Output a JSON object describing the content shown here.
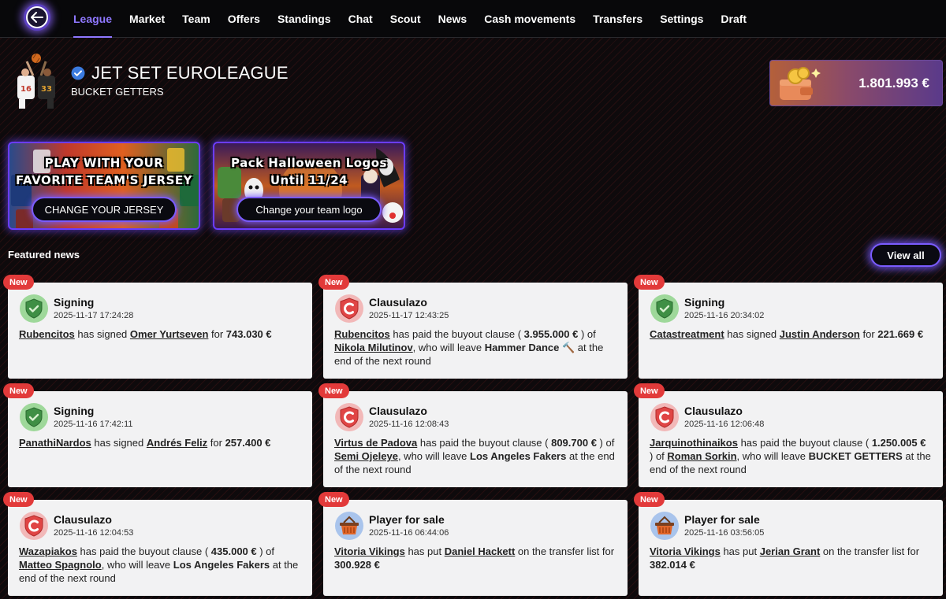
{
  "nav": {
    "tabs": [
      "League",
      "Market",
      "Team",
      "Offers",
      "Standings",
      "Chat",
      "Scout",
      "News",
      "Cash movements",
      "Transfers",
      "Settings",
      "Draft"
    ],
    "active": "League"
  },
  "header": {
    "league_title": "JET SET EUROLEAGUE",
    "team_name": "BUCKET GETTERS",
    "balance": "1.801.993 €"
  },
  "banners": [
    {
      "title_line1": "PLAY WITH YOUR",
      "title_line2": "FAVORITE TEAM'S JERSEY",
      "button": "CHANGE YOUR JERSEY"
    },
    {
      "title_line1": "Pack Halloween Logos",
      "title_line2": "Until 11/24",
      "button": "Change your team logo"
    }
  ],
  "featured": {
    "label": "Featured news",
    "view_all": "View all"
  },
  "news": [
    {
      "badge": "New",
      "type": "Signing",
      "time": "2025-11-17 17:24:28",
      "icon": "shield-check-icon",
      "parts": [
        [
          "lnk",
          "Rubencitos"
        ],
        [
          "t",
          " has signed "
        ],
        [
          "lnk",
          "Omer Yurtseven"
        ],
        [
          "t",
          " for "
        ],
        [
          "b",
          "743.030 €"
        ]
      ]
    },
    {
      "badge": "New",
      "type": "Clausulazo",
      "time": "2025-11-17 12:43:25",
      "icon": "clause-shield-icon",
      "parts": [
        [
          "lnk",
          "Rubencitos"
        ],
        [
          "t",
          " has paid the buyout clause ( "
        ],
        [
          "b",
          "3.955.000 €"
        ],
        [
          "t",
          " ) of "
        ],
        [
          "lnk",
          "Nikola Milutinov"
        ],
        [
          "t",
          ", who will leave "
        ],
        [
          "b",
          "Hammer Dance 🔨"
        ],
        [
          "t",
          " at the end of the next round"
        ]
      ]
    },
    {
      "badge": "New",
      "type": "Signing",
      "time": "2025-11-16 20:34:02",
      "icon": "shield-check-icon",
      "parts": [
        [
          "lnk",
          "Catastreatment"
        ],
        [
          "t",
          " has signed "
        ],
        [
          "lnk",
          "Justin Anderson"
        ],
        [
          "t",
          " for "
        ],
        [
          "b",
          "221.669 €"
        ]
      ]
    },
    {
      "badge": "New",
      "type": "Signing",
      "time": "2025-11-16 17:42:11",
      "icon": "shield-check-icon",
      "parts": [
        [
          "lnk",
          "PanathiNardos"
        ],
        [
          "t",
          " has signed "
        ],
        [
          "lnk",
          "Andrés Feliz"
        ],
        [
          "t",
          " for "
        ],
        [
          "b",
          "257.400 €"
        ]
      ]
    },
    {
      "badge": "New",
      "type": "Clausulazo",
      "time": "2025-11-16 12:08:43",
      "icon": "clause-shield-icon",
      "parts": [
        [
          "lnk",
          "Virtus de Padova"
        ],
        [
          "t",
          " has paid the buyout clause ( "
        ],
        [
          "b",
          "809.700 €"
        ],
        [
          "t",
          " ) of "
        ],
        [
          "lnk",
          "Semi Ojeleye"
        ],
        [
          "t",
          ", who will leave "
        ],
        [
          "b",
          "Los Angeles Fakers"
        ],
        [
          "t",
          " at the end of the next round"
        ]
      ]
    },
    {
      "badge": "New",
      "type": "Clausulazo",
      "time": "2025-11-16 12:06:48",
      "icon": "clause-shield-icon",
      "parts": [
        [
          "lnk",
          "Jarquinothinaikos"
        ],
        [
          "t",
          " has paid the buyout clause ( "
        ],
        [
          "b",
          "1.250.005 €"
        ],
        [
          "t",
          " ) of "
        ],
        [
          "lnk",
          "Roman Sorkin"
        ],
        [
          "t",
          ", who will leave "
        ],
        [
          "b",
          "BUCKET GETTERS"
        ],
        [
          "t",
          " at the end of the next round"
        ]
      ]
    },
    {
      "badge": "New",
      "type": "Clausulazo",
      "time": "2025-11-16 12:04:53",
      "icon": "clause-shield-icon",
      "parts": [
        [
          "lnk",
          "Wazapiakos"
        ],
        [
          "t",
          " has paid the buyout clause ( "
        ],
        [
          "b",
          "435.000 €"
        ],
        [
          "t",
          " ) of "
        ],
        [
          "lnk",
          "Matteo Spagnolo"
        ],
        [
          "t",
          ", who will leave "
        ],
        [
          "b",
          "Los Angeles Fakers"
        ],
        [
          "t",
          " at the end of the next round"
        ]
      ]
    },
    {
      "badge": "New",
      "type": "Player for sale",
      "time": "2025-11-16 06:44:06",
      "icon": "basket-icon",
      "parts": [
        [
          "lnk",
          "Vitoria Vikings"
        ],
        [
          "t",
          " has put "
        ],
        [
          "lnk",
          "Daniel Hackett"
        ],
        [
          "t",
          " on the transfer list for "
        ],
        [
          "b",
          "300.928 €"
        ]
      ]
    },
    {
      "badge": "New",
      "type": "Player for sale",
      "time": "2025-11-16 03:56:05",
      "icon": "basket-icon",
      "parts": [
        [
          "lnk",
          "Vitoria Vikings"
        ],
        [
          "t",
          " has put "
        ],
        [
          "lnk",
          "Jerian Grant"
        ],
        [
          "t",
          " on the transfer list for "
        ],
        [
          "b",
          "382.014 €"
        ]
      ]
    }
  ]
}
